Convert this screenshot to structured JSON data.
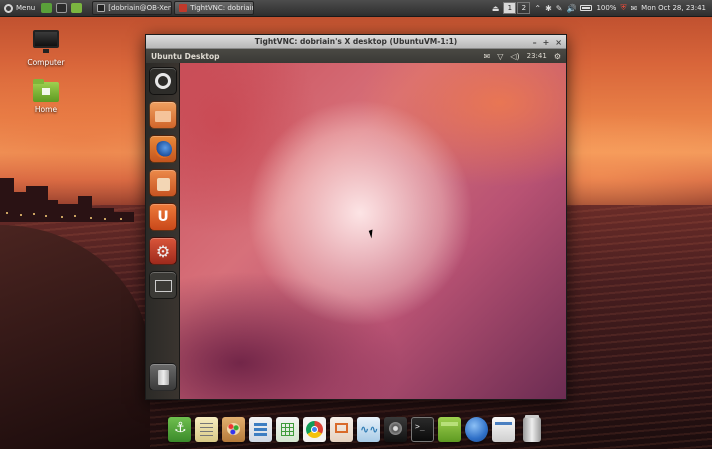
{
  "top_panel": {
    "menu_label": "Menu",
    "tasks": [
      {
        "label": "[dobriain@OB-Xen:",
        "icon": "terminal-icon",
        "active": false
      },
      {
        "label": "TightVNC: dobriain'...",
        "icon": "vnc-icon",
        "active": true
      }
    ],
    "workspaces": [
      "1",
      "2"
    ],
    "current_workspace": "1",
    "battery_text": "100%",
    "datetime": "Mon Oct 28, 23:41"
  },
  "desktop_icons": [
    {
      "label": "Computer",
      "icon": "computer-icon"
    },
    {
      "label": "Home",
      "icon": "home-folder-icon"
    }
  ],
  "vnc_window": {
    "title": "TightVNC: dobriain's X desktop (UbuntuVM-1:1)",
    "controls": [
      "–",
      "+",
      "×"
    ],
    "ubuntu": {
      "panel_title": "Ubuntu Desktop",
      "clock": "23:41",
      "launcher_items": [
        {
          "name": "dash-home",
          "icon": "ubuntu-logo-icon",
          "color": "#3c3b37"
        },
        {
          "name": "files",
          "icon": "files-folder-icon",
          "color": "#e0772e"
        },
        {
          "name": "firefox",
          "icon": "firefox-icon",
          "color": "#e66c1f"
        },
        {
          "name": "software-center",
          "icon": "shopping-bag-icon",
          "color": "#e06a2c"
        },
        {
          "name": "ubuntu-one",
          "icon": "ubuntu-one-icon",
          "color": "#dd5a1e"
        },
        {
          "name": "system-settings",
          "icon": "settings-icon",
          "color": "#c0392b"
        },
        {
          "name": "workspace-switcher",
          "icon": "workspace-icon",
          "color": "#3a3a3a"
        },
        {
          "name": "trash",
          "icon": "trash-icon",
          "color": "#555555"
        }
      ]
    }
  },
  "dock": [
    {
      "name": "anchor-app",
      "icon": "anchor-icon",
      "color": "#4e9a3a"
    },
    {
      "name": "text-editor",
      "icon": "notepad-icon",
      "color": "#e8dca6"
    },
    {
      "name": "paint",
      "icon": "palette-icon",
      "color": "#c98a4a"
    },
    {
      "name": "writer",
      "icon": "document-icon",
      "color": "#3d7ec2"
    },
    {
      "name": "calc",
      "icon": "spreadsheet-icon",
      "color": "#3e9b3a"
    },
    {
      "name": "chrome",
      "icon": "chrome-icon",
      "color": "#d94b3a"
    },
    {
      "name": "presentation",
      "icon": "presentation-icon",
      "color": "#d96a2a"
    },
    {
      "name": "monitor",
      "icon": "system-monitor-icon",
      "color": "#2e7bb4"
    },
    {
      "name": "media",
      "icon": "speaker-icon",
      "color": "#2a2a2a"
    },
    {
      "name": "terminal",
      "icon": "terminal-icon",
      "color": "#1e1e1e"
    },
    {
      "name": "files",
      "icon": "folder-icon",
      "color": "#6fae3a"
    },
    {
      "name": "network",
      "icon": "globe-icon",
      "color": "#2f70c8"
    },
    {
      "name": "window",
      "icon": "window-icon",
      "color": "#dcdcdc"
    },
    {
      "name": "trash",
      "icon": "trash-icon",
      "color": "#bfbfbf"
    }
  ]
}
